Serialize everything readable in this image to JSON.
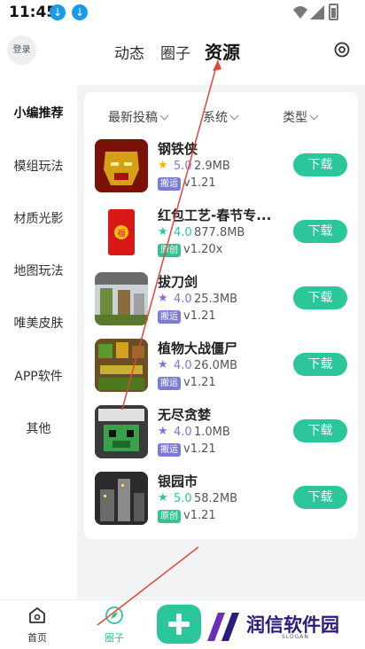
{
  "status": {
    "time": "11:45"
  },
  "header": {
    "login": "登录",
    "tabs": [
      "动态",
      "圈子",
      "资源"
    ],
    "active_tab": "资源"
  },
  "sidebar": {
    "items": [
      "小编推荐",
      "模组玩法",
      "材质光影",
      "地图玩法",
      "唯美皮肤",
      "APP软件",
      "其他"
    ],
    "active": "小编推荐"
  },
  "filters": {
    "sort": "最新投稿",
    "system": "系统",
    "type": "类型"
  },
  "list": [
    {
      "title": "钢铁侠",
      "rating": "5.0",
      "size": "2.9MB",
      "badge": "搬运",
      "version": "v1.21",
      "button": "下载"
    },
    {
      "title": "红包工艺-春节专...",
      "rating": "4.0",
      "size": "877.8MB",
      "badge": "原创",
      "version": "v1.20x",
      "button": "下载"
    },
    {
      "title": "拔刀剑",
      "rating": "4.0",
      "size": "25.3MB",
      "badge": "搬运",
      "version": "v1.21",
      "button": "下载"
    },
    {
      "title": "植物大战僵尸",
      "rating": "4.0",
      "size": "26.0MB",
      "badge": "搬运",
      "version": "v1.21",
      "button": "下载"
    },
    {
      "title": "无尽贪婪",
      "rating": "4.0",
      "size": "1.0MB",
      "badge": "搬运",
      "version": "v1.21",
      "button": "下载"
    },
    {
      "title": "银园市",
      "rating": "5.0",
      "size": "58.2MB",
      "badge": "原创",
      "version": "v1.21",
      "button": "下载"
    }
  ],
  "bottom_nav": {
    "home": "首页",
    "circle": "圈子"
  },
  "watermark": {
    "name": "润信软件园",
    "slogan": "SLOGAN"
  },
  "colors": {
    "accent": "#2bc69a",
    "badge_ban": "#7a7ad8",
    "badge_yuan": "#34c38f"
  }
}
